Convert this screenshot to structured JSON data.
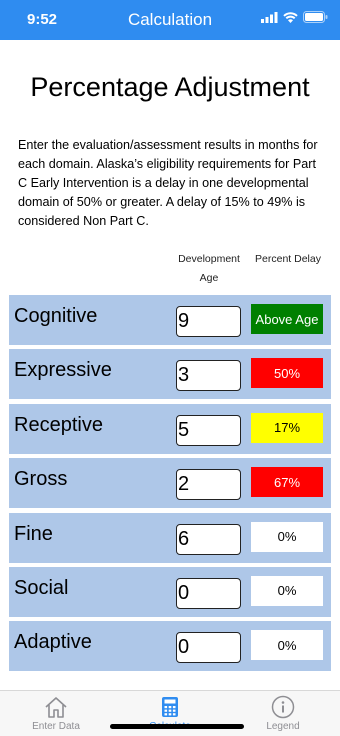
{
  "status_bar": {
    "time": "9:52"
  },
  "nav": {
    "title": "Calculation"
  },
  "page": {
    "title": "Percentage Adjustment",
    "intro": "Enter the evaluation/assessment results in months for each domain. Alaska’s eligibility requirements for Part C Early Intervention is a delay in one developmental domain of 50% or greater. A delay of 15% to 49% is considered Non Part C."
  },
  "columns": {
    "development_age": "Development Age",
    "percent_delay": "Percent Delay"
  },
  "domains": [
    {
      "label": "Cognitive",
      "age": "9",
      "delay": "Above Age",
      "color": "#008000",
      "text_color": "#ffffff"
    },
    {
      "label": "Expressive",
      "age": "3",
      "delay": "50%",
      "color": "#ff0000",
      "text_color": "#ffffff"
    },
    {
      "label": "Receptive",
      "age": "5",
      "delay": "17%",
      "color": "#ffff00",
      "text_color": "#000000"
    },
    {
      "label": "Gross",
      "age": "2",
      "delay": "67%",
      "color": "#ff0000",
      "text_color": "#ffffff"
    },
    {
      "label": "Fine",
      "age": "6",
      "delay": "0%",
      "color": "#ffffff",
      "text_color": "#000000"
    },
    {
      "label": "Social",
      "age": "0",
      "delay": "0%",
      "color": "#ffffff",
      "text_color": "#000000"
    },
    {
      "label": "Adaptive",
      "age": "0",
      "delay": "0%",
      "color": "#ffffff",
      "text_color": "#000000"
    }
  ],
  "tabs": [
    {
      "label": "Enter Data",
      "icon": "home-icon"
    },
    {
      "label": "Calculate",
      "icon": "calculator-icon",
      "active": true
    },
    {
      "label": "Legend",
      "icon": "info-icon"
    }
  ],
  "colors": {
    "accent": "#2f8cf0",
    "row_bg": "#aec7e8"
  }
}
